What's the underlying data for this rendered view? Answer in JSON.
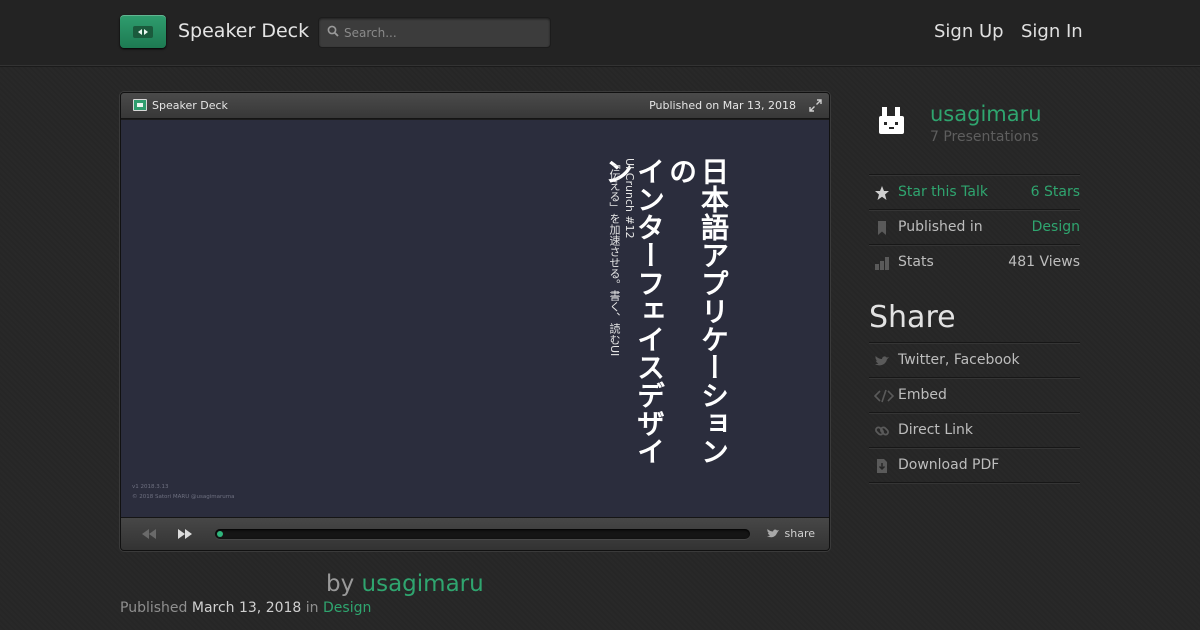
{
  "header": {
    "brand": "Speaker Deck",
    "search_placeholder": "Search...",
    "sign_up": "Sign Up",
    "sign_in": "Sign In"
  },
  "player": {
    "brand": "Speaker Deck",
    "published": "Published on Mar 13, 2018",
    "share_label": "share",
    "progress_fraction": 0.01,
    "slide": {
      "title_lines": [
        "日本語アプリケーションの",
        "インターフェイスデザイン"
      ],
      "subtitle_lines": [
        "UI Crunch #12",
        "「伝える」を加速させる。書く、読むUI"
      ],
      "footer_lines": [
        "v1 2018.3.13",
        "© 2018 Satori MARU @usagimaruma"
      ]
    }
  },
  "byline": {
    "prefix": "by",
    "author": "usagimaru"
  },
  "published_line": {
    "prefix": "Published",
    "date": "March 13, 2018",
    "in": "in",
    "category": "Design"
  },
  "sidebar": {
    "user_name": "usagimaru",
    "presentations": "7 Presentations",
    "star_label": "Star this Talk",
    "stars": "6 Stars",
    "published_in_label": "Published in",
    "published_in_value": "Design",
    "stats_label": "Stats",
    "views": "481 Views",
    "share_heading": "Share",
    "share_items": [
      "Twitter, Facebook",
      "Embed",
      "Direct Link",
      "Download PDF"
    ]
  },
  "colors": {
    "accent": "#2fa56f",
    "background": "#262626",
    "slide_background": "#2b2d3d"
  },
  "icons": [
    "search-icon",
    "expand-icon",
    "rewind-icon",
    "forward-icon",
    "twitter-icon",
    "star-icon",
    "bookmark-icon",
    "stats-icon",
    "code-icon",
    "link-icon",
    "download-icon"
  ]
}
